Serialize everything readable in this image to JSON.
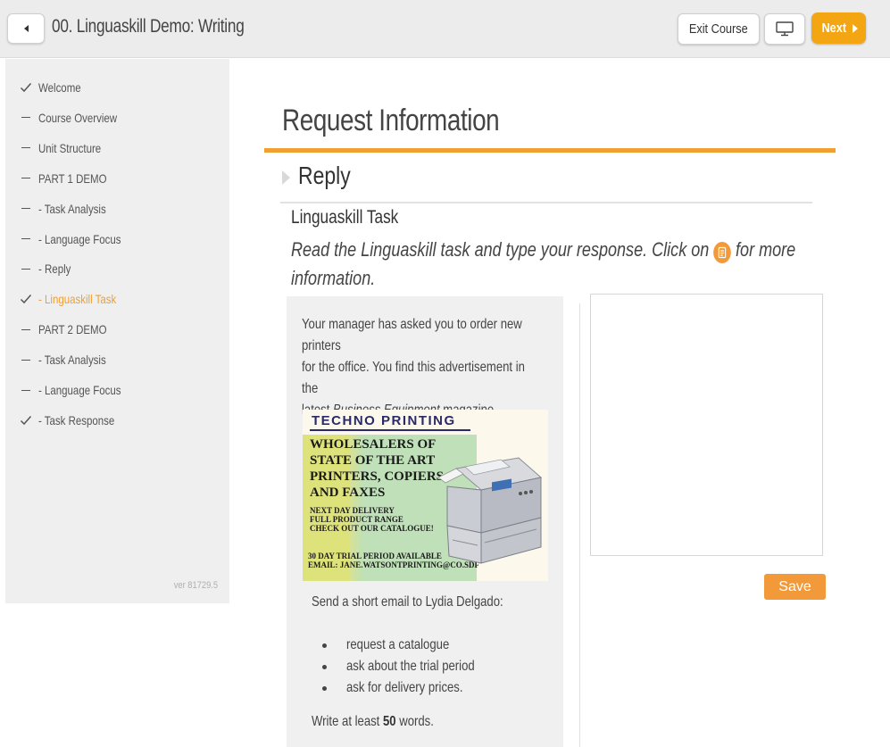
{
  "header": {
    "course_title": "00. Linguaskill Demo: Writing",
    "exit_label": "Exit Course",
    "next_label": "Next"
  },
  "sidebar": {
    "items": [
      {
        "label": "Welcome",
        "mark": "check",
        "active": false
      },
      {
        "label": "Course Overview",
        "mark": "dash",
        "active": false
      },
      {
        "label": "Unit Structure",
        "mark": "dash",
        "active": false
      },
      {
        "label": "PART 1 DEMO",
        "mark": "dash",
        "active": false
      },
      {
        "label": "- Task Analysis",
        "mark": "dash",
        "active": false
      },
      {
        "label": "- Language Focus",
        "mark": "dash",
        "active": false
      },
      {
        "label": "- Reply",
        "mark": "dash",
        "active": false
      },
      {
        "label": "- Linguaskill Task",
        "mark": "check",
        "active": true
      },
      {
        "label": "PART 2 DEMO",
        "mark": "dash",
        "active": false
      },
      {
        "label": "- Task Analysis",
        "mark": "dash",
        "active": false
      },
      {
        "label": "- Language Focus",
        "mark": "dash",
        "active": false
      },
      {
        "label": "- Task Response",
        "mark": "check",
        "active": false
      }
    ],
    "version": "ver 81729.5"
  },
  "main": {
    "page_title": "Request Information",
    "section_title": "Reply",
    "task_heading": "Linguaskill Task",
    "instruction_part1": "Read the Linguaskill task and type your response. Click on",
    "instruction_part2": "for more",
    "instruction_part3": "information."
  },
  "task": {
    "intro_line1": "Your manager has asked you to order new printers",
    "intro_line2": "for the office. You find this advertisement in the",
    "intro_line3_pre": "latest",
    "intro_line3_italic": "Business Equipment",
    "intro_line3_post": "magazine.",
    "ad": {
      "title": "TECHNO PRINTING",
      "line1": "WHOLESALERS OF",
      "line2": "STATE OF THE ART",
      "line3": "PRINTERS, COPIERS",
      "line4": "AND FAXES",
      "small1": "NEXT DAY DELIVERY",
      "small2": "FULL PRODUCT RANGE",
      "small3": "CHECK OUT OUR CATALOGUE!",
      "foot1": "30 DAY TRIAL PERIOD AVAILABLE",
      "foot2": "EMAIL: JANE.WATSONTPRINTING@CO.SDF"
    },
    "send_text": "Send a short email to Lydia Delgado:",
    "bullets": [
      "request a catalogue",
      "ask about the trial period",
      "ask for delivery prices."
    ],
    "write_pre": "Write at least",
    "write_count": "50",
    "write_post": "words."
  },
  "response": {
    "value": "",
    "save_label": "Save"
  },
  "colors": {
    "accent": "#f0a030",
    "next_button": "#f3a512",
    "save_button": "#f29a3a"
  }
}
